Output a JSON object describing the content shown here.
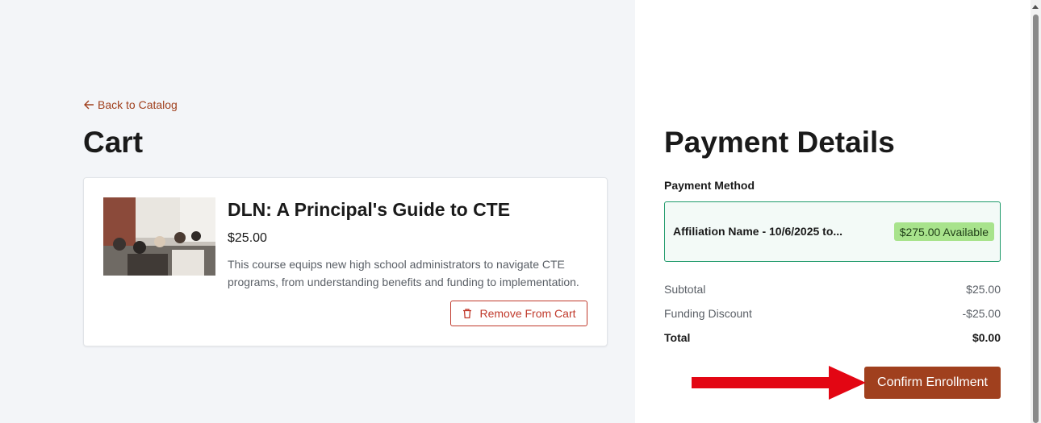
{
  "nav": {
    "back_label": "Back to Catalog"
  },
  "cart": {
    "title": "Cart",
    "item": {
      "name": "DLN: A Principal's Guide to CTE",
      "price": "$25.00",
      "description": "This course equips new high school administrators to navigate CTE programs, from understanding benefits and funding to implementation.",
      "remove_label": "Remove From Cart"
    }
  },
  "payment": {
    "title": "Payment Details",
    "method_label": "Payment Method",
    "method": {
      "name": "Affiliation Name - 10/6/2025 to...",
      "available": "$275.00 Available"
    },
    "summary": {
      "subtotal_label": "Subtotal",
      "subtotal_value": "$25.00",
      "discount_label": "Funding Discount",
      "discount_value": "-$25.00",
      "total_label": "Total",
      "total_value": "$0.00"
    },
    "confirm_label": "Confirm Enrollment"
  },
  "colors": {
    "accent": "#a0401e",
    "remove": "#c0392b",
    "method_border": "#1f9a6b",
    "badge": "#a8e38c",
    "arrow": "#e30613"
  },
  "icons": {
    "back": "arrow-left-icon",
    "remove": "trash-icon",
    "pointer": "red-arrow-icon"
  }
}
